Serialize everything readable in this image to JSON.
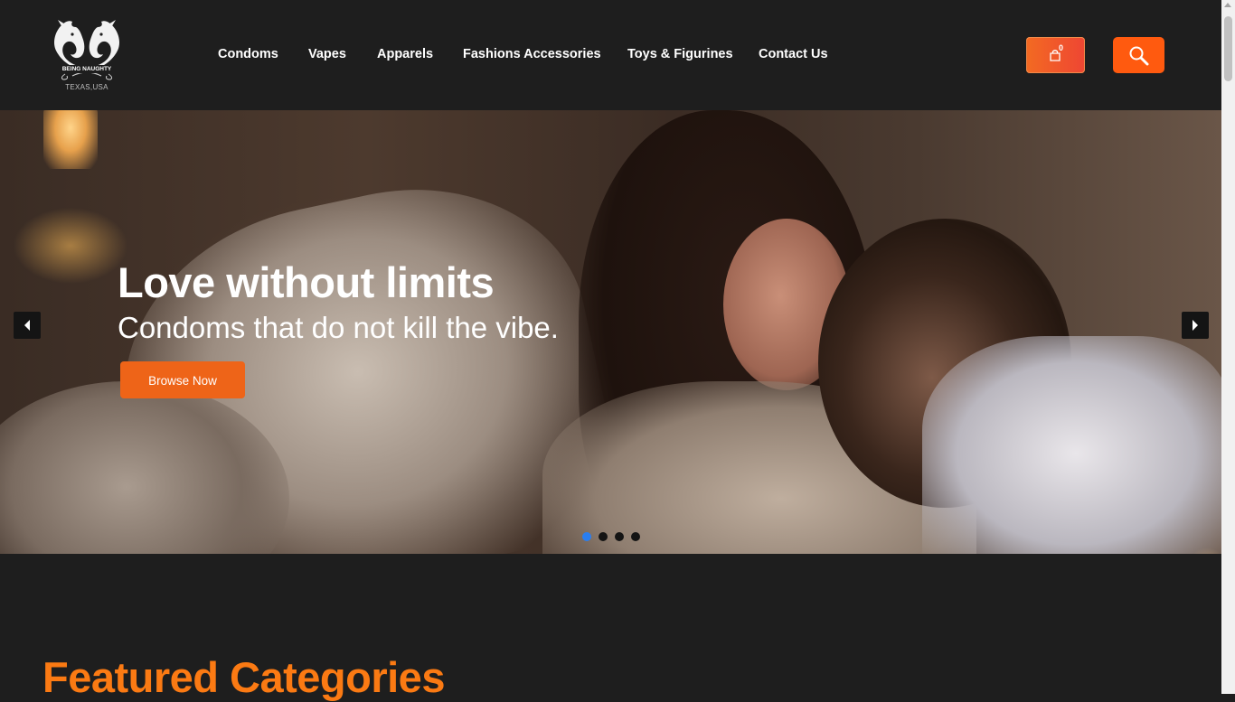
{
  "brand": {
    "logo_text": "BEING NAUGHTY",
    "location": "TEXAS,USA"
  },
  "nav": {
    "items": [
      {
        "label": "Condoms"
      },
      {
        "label": "Vapes"
      },
      {
        "label": "Apparels"
      },
      {
        "label": "Fashions Accessories"
      },
      {
        "label": "Toys & Figurines"
      },
      {
        "label": "Contact Us"
      }
    ]
  },
  "header_actions": {
    "cart_icon": "cart-bag-icon",
    "cart_count": "0",
    "search_icon": "search-icon",
    "accent_color": "#ff5a0f"
  },
  "hero": {
    "title": "Love without limits",
    "subtitle": "Condoms that do not kill the vibe.",
    "cta_label": "Browse Now",
    "cta_color": "#ee6418",
    "prev_icon": "caret-left-icon",
    "next_icon": "caret-right-icon",
    "slide_count": 4,
    "active_slide": 1,
    "active_dot_color": "#2a7ef0"
  },
  "featured": {
    "title": "Featured Categories",
    "title_color": "#fb7a13"
  }
}
